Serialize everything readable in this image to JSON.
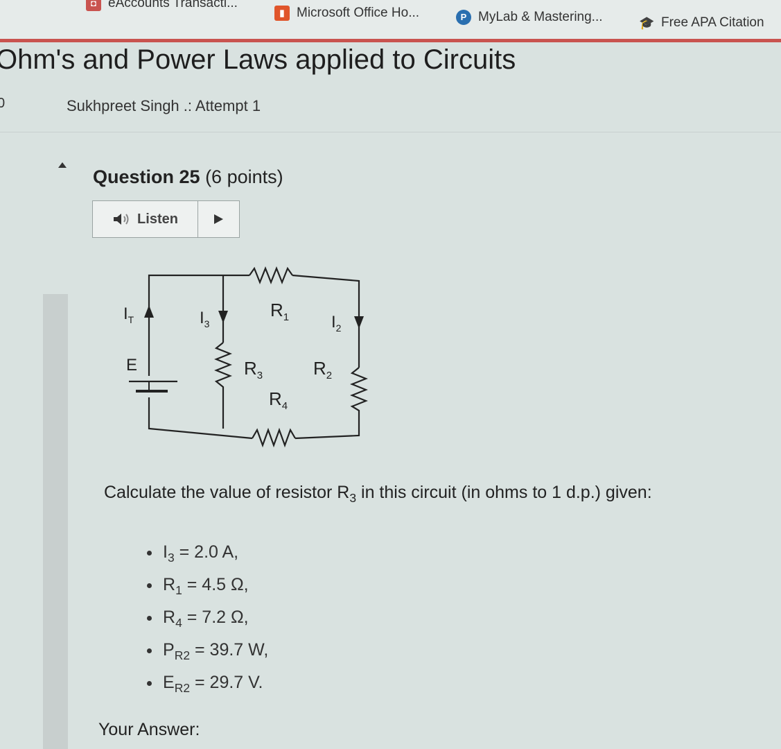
{
  "bookmarks": [
    {
      "label": "eAccounts Transacti...",
      "icon": "folder-icon",
      "color": "#c9534f"
    },
    {
      "label": "Microsoft Office Ho...",
      "icon": "office-icon",
      "color": "#e0552b"
    },
    {
      "label": "MyLab & Mastering...",
      "icon": "pearson-icon",
      "color": "#2a6fb0"
    },
    {
      "label": "Free APA Citation",
      "icon": "mortarboard-icon",
      "color": "#555555"
    }
  ],
  "page": {
    "title": "Ohm's and Power Laws applied to Circuits",
    "left_number": "0",
    "attempt": "Sukhpreet Singh .: Attempt 1"
  },
  "question": {
    "number": "Question 25",
    "points": "(6 points)",
    "listen_label": "Listen",
    "prompt_pre": "Calculate the value of resistor R",
    "prompt_sub": "3",
    "prompt_post": " in this circuit (in ohms to 1 d.p.) given:",
    "givens": [
      {
        "sym": "I",
        "sub": "3",
        "rest": " = 2.0 A,"
      },
      {
        "sym": "R",
        "sub": "1",
        "rest": " = 4.5 Ω,"
      },
      {
        "sym": "R",
        "sub": "4",
        "rest": " = 7.2 Ω,"
      },
      {
        "sym": "P",
        "sub": "R2",
        "rest": " = 39.7 W,"
      },
      {
        "sym": "E",
        "sub": "R2",
        "rest": " = 29.7 V."
      }
    ],
    "answer_label": "Your Answer:"
  },
  "circuit": {
    "labels": {
      "it_main": "I",
      "it_sub": "T",
      "i3_main": "I",
      "i3_sub": "3",
      "r1_main": "R",
      "r1_sub": "1",
      "i2_main": "I",
      "i2_sub": "2",
      "e": "E",
      "r3_main": "R",
      "r3_sub": "3",
      "r2_main": "R",
      "r2_sub": "2",
      "r4_main": "R",
      "r4_sub": "4"
    }
  }
}
